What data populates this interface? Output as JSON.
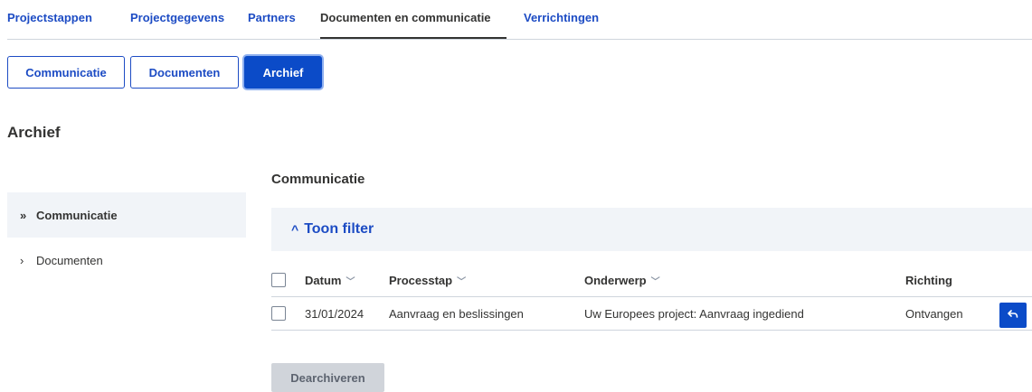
{
  "top_tabs": [
    {
      "label": "Projectstappen"
    },
    {
      "label": "Projectgegevens"
    },
    {
      "label": "Partners"
    },
    {
      "label": "Documenten en communicatie"
    },
    {
      "label": "Verrichtingen"
    }
  ],
  "segments": [
    {
      "label": "Communicatie"
    },
    {
      "label": "Documenten"
    },
    {
      "label": "Archief"
    }
  ],
  "active_segment": "Archief",
  "section_title": "Archief",
  "side_nav": [
    {
      "label": "Communicatie",
      "chevron": "»"
    },
    {
      "label": "Documenten",
      "chevron": "›"
    }
  ],
  "content_title": "Communicatie",
  "filter": {
    "label": "Toon filter",
    "chevron": "^"
  },
  "table": {
    "columns": [
      {
        "label": "Datum",
        "sortable": true
      },
      {
        "label": "Processtap",
        "sortable": true
      },
      {
        "label": "Onderwerp",
        "sortable": true
      },
      {
        "label": "Richting",
        "sortable": false
      }
    ],
    "rows": [
      {
        "datum": "31/01/2024",
        "processtap": "Aanvraag en beslissingen",
        "onderwerp": "Uw Europees project: Aanvraag ingediend",
        "richting": "Ontvangen"
      }
    ]
  },
  "dearchive_button": "Dearchiveren",
  "icons": {
    "reply": "reply-icon",
    "sort": "chevron-down-icon"
  },
  "colors": {
    "primary": "#0b4bc8",
    "link": "#1d4cc4",
    "panel": "#f1f4f8",
    "disabled": "#d0d4da"
  }
}
